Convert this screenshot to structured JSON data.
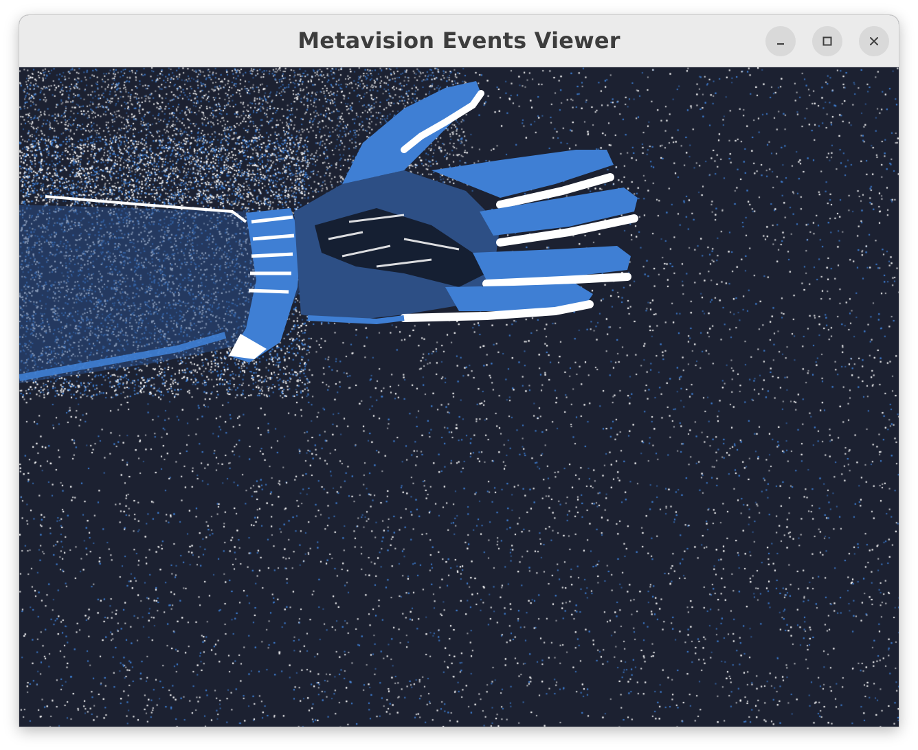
{
  "window": {
    "title": "Metavision Events Viewer",
    "controls": {
      "minimize_icon": "minimize-icon",
      "maximize_icon": "maximize-icon",
      "close_icon": "close-icon"
    }
  },
  "viewer": {
    "background_color": "#1c2131",
    "positive_event_color": "#ffffff",
    "negative_event_color": "#3f7fd4"
  }
}
